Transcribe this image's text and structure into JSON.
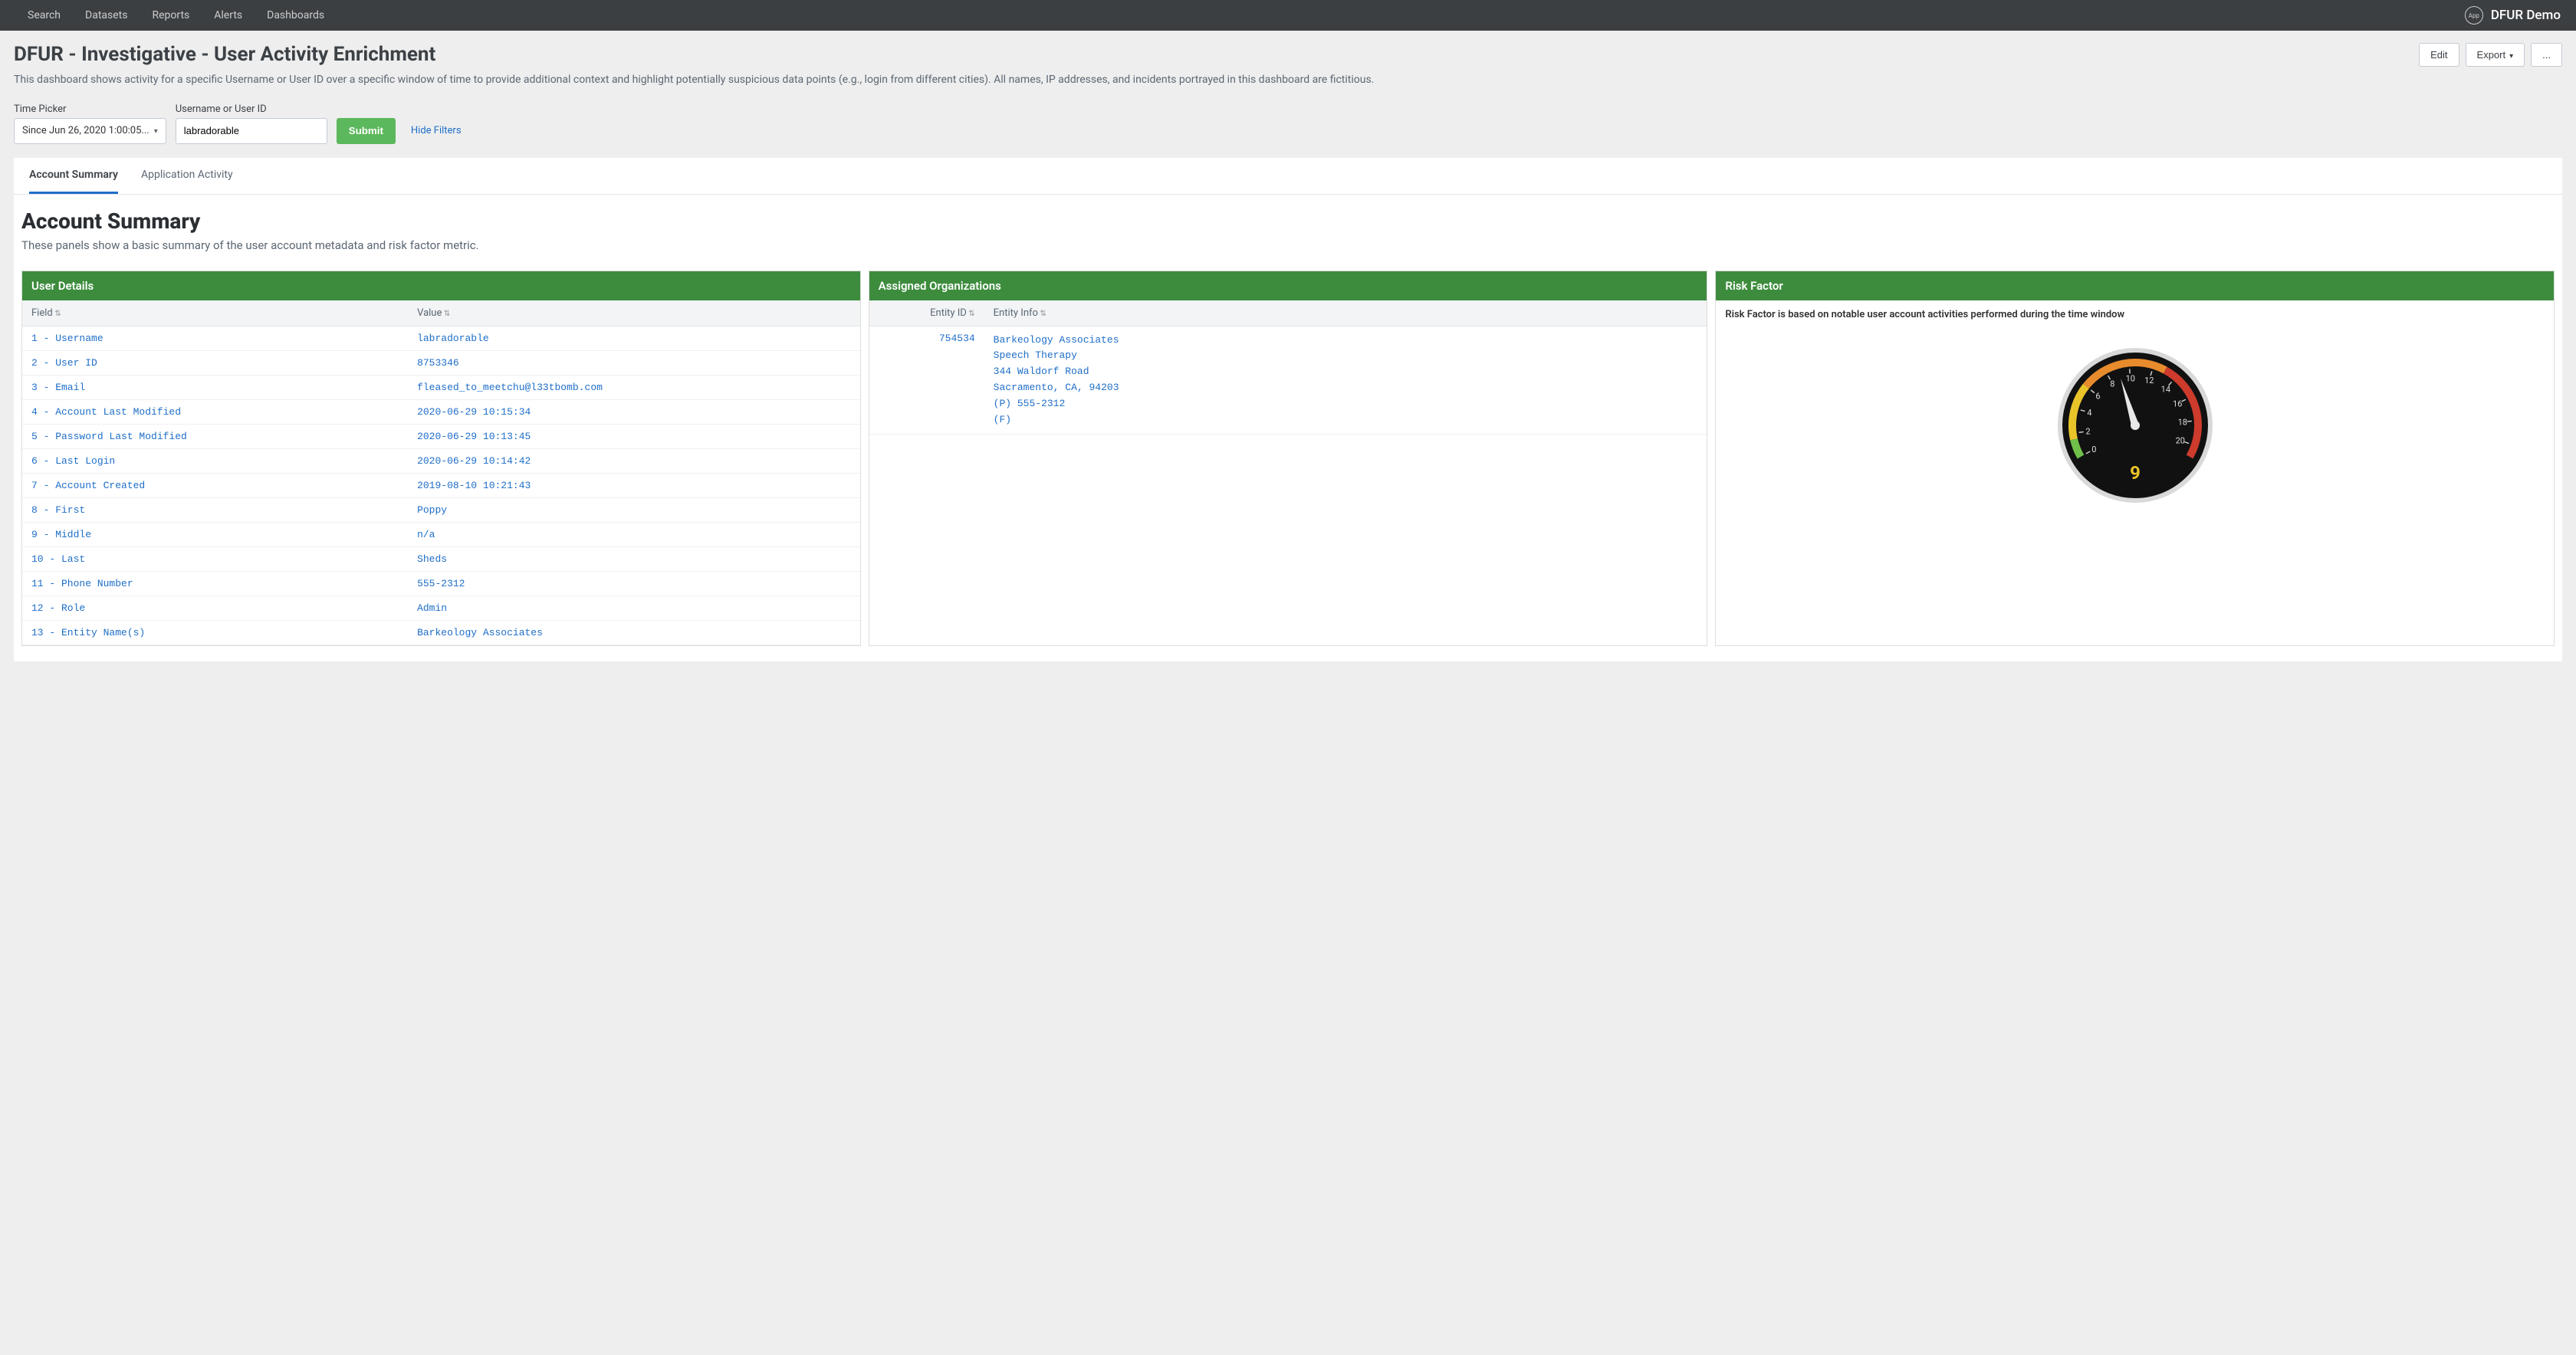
{
  "topnav": {
    "items": [
      "Search",
      "Datasets",
      "Reports",
      "Alerts",
      "Dashboards"
    ],
    "app_badge": "App",
    "app_name": "DFUR Demo"
  },
  "header": {
    "title": "DFUR - Investigative - User Activity Enrichment",
    "description": "This dashboard shows activity for a specific Username or User ID over a specific window of time to provide additional context and highlight potentially suspicious data points (e.g., login from different cities). All names, IP addresses, and incidents portrayed in this dashboard are fictitious.",
    "edit": "Edit",
    "export": "Export",
    "more": "..."
  },
  "filters": {
    "time_label": "Time Picker",
    "time_value": "Since Jun 26, 2020 1:00:05...",
    "username_label": "Username or User ID",
    "username_value": "labradorable",
    "submit": "Submit",
    "hide": "Hide Filters"
  },
  "tabs": [
    {
      "label": "Account Summary",
      "active": true
    },
    {
      "label": "Application Activity",
      "active": false
    }
  ],
  "section": {
    "title": "Account Summary",
    "description": "These panels show a basic summary of the user account metadata and risk factor metric."
  },
  "panels": {
    "user_details": {
      "title": "User Details",
      "columns": [
        "Field",
        "Value"
      ],
      "rows": [
        {
          "field": "1 - Username",
          "value": "labradorable"
        },
        {
          "field": "2 - User ID",
          "value": "8753346"
        },
        {
          "field": "3 - Email",
          "value": "fleased_to_meetchu@l33tbomb.com"
        },
        {
          "field": "4 - Account Last Modified",
          "value": "2020-06-29 10:15:34"
        },
        {
          "field": "5 - Password Last Modified",
          "value": "2020-06-29 10:13:45"
        },
        {
          "field": "6 - Last Login",
          "value": "2020-06-29 10:14:42"
        },
        {
          "field": "7 - Account Created",
          "value": "2019-08-10 10:21:43"
        },
        {
          "field": "8 - First",
          "value": "Poppy"
        },
        {
          "field": "9 - Middle",
          "value": "n/a"
        },
        {
          "field": "10 - Last",
          "value": "Sheds"
        },
        {
          "field": "11 - Phone Number",
          "value": "555-2312"
        },
        {
          "field": "12 - Role",
          "value": "Admin"
        },
        {
          "field": "13 - Entity Name(s)",
          "value": "Barkeology Associates"
        }
      ]
    },
    "assigned_orgs": {
      "title": "Assigned Organizations",
      "columns": [
        "Entity ID",
        "Entity Info"
      ],
      "rows": [
        {
          "entity_id": "754534",
          "entity_info": "Barkeology Associates\nSpeech Therapy\n344 Waldorf Road\nSacramento, CA, 94203\n(P) 555-2312\n(F)"
        }
      ]
    },
    "risk_factor": {
      "title": "Risk Factor",
      "note": "Risk Factor is based on notable user account activities performed during the time window",
      "value": 9,
      "min": 0,
      "max": 21,
      "ticks": [
        0,
        2,
        4,
        6,
        8,
        10,
        12,
        14,
        16,
        18,
        20
      ]
    }
  },
  "chart_data": {
    "type": "gauge",
    "title": "Risk Factor",
    "value": 9,
    "min": 0,
    "max": 21,
    "ticks": [
      0,
      2,
      4,
      6,
      8,
      10,
      12,
      14,
      16,
      18,
      20
    ],
    "color_stops": [
      {
        "at": 0,
        "color": "#6fbf4b"
      },
      {
        "at": 3,
        "color": "#e9c429"
      },
      {
        "at": 7,
        "color": "#e88b2d"
      },
      {
        "at": 14,
        "color": "#cc3b2c"
      }
    ]
  }
}
